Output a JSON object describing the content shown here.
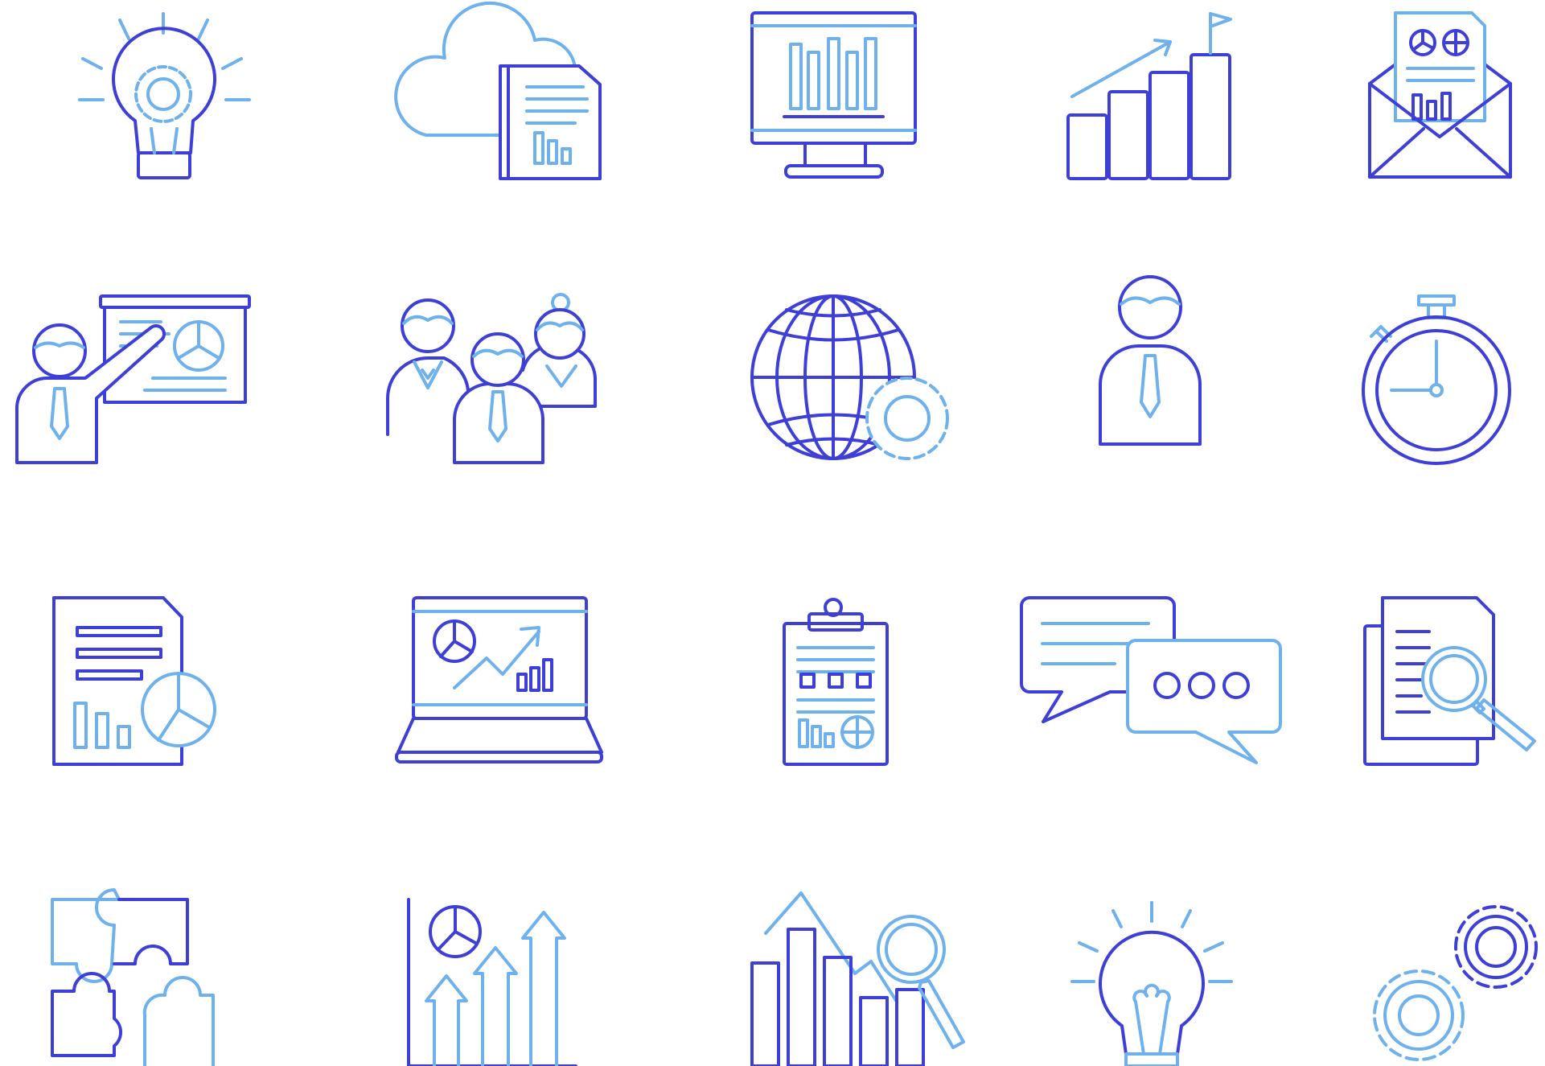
{
  "colors": {
    "primary": "#3d3fd6",
    "secondary": "#6eb1ec",
    "background": "#ffffff"
  },
  "icons": [
    "lightbulb-gear-icon",
    "cloud-document-icon",
    "monitor-chart-icon",
    "growth-flag-icon",
    "envelope-report-icon",
    "presentation-icon",
    "team-icon",
    "globe-gear-icon",
    "businessman-icon",
    "stopwatch-icon",
    "document-report-icon",
    "laptop-analytics-icon",
    "clipboard-report-icon",
    "chat-bubbles-icon",
    "document-search-icon",
    "puzzle-icon",
    "growth-arrows-icon",
    "chart-magnifier-icon",
    "lightbulb-icon",
    "gears-icon"
  ]
}
